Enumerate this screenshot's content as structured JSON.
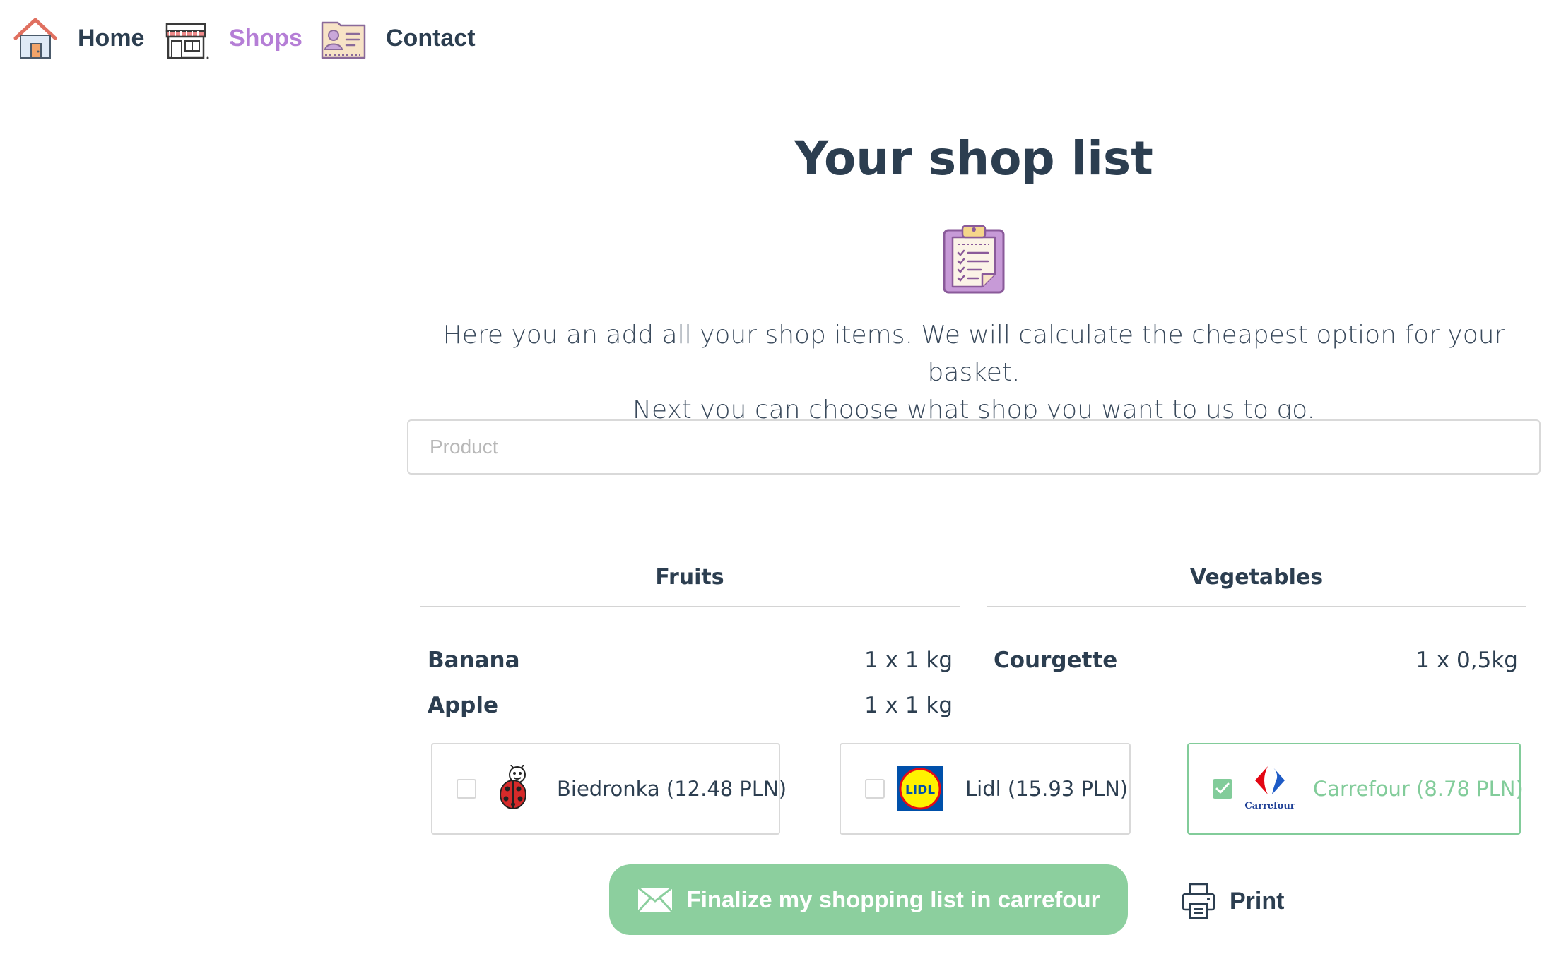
{
  "nav": {
    "items": [
      {
        "label": "Home",
        "icon": "house-icon",
        "active": false
      },
      {
        "label": "Shops",
        "icon": "shop-icon",
        "active": true
      },
      {
        "label": "Contact",
        "icon": "contact-card-icon",
        "active": false
      }
    ]
  },
  "header": {
    "title": "Your shop list",
    "icon": "clipboard-icon",
    "description_line1": "Here you an add all your shop items. We will calculate the cheapest option for your basket.",
    "description_line2": "Next you can choose what shop you want to us to go."
  },
  "search": {
    "placeholder": "Product",
    "value": ""
  },
  "categories": [
    {
      "title": "Fruits",
      "items": [
        {
          "name": "Banana",
          "qty": "1 x 1 kg"
        },
        {
          "name": "Apple",
          "qty": "1 x 1 kg"
        }
      ]
    },
    {
      "title": "Vegetables",
      "items": [
        {
          "name": "Courgette",
          "qty": "1 x 0,5kg"
        }
      ]
    }
  ],
  "shops": [
    {
      "label": "Biedronka (12.48 PLN)",
      "logo": "ladybug-logo",
      "checked": false
    },
    {
      "label": "Lidl (15.93 PLN)",
      "logo": "lidl-logo",
      "logo_text": "LIDL",
      "checked": false
    },
    {
      "label": "Carrefour (8.78 PLN)",
      "logo": "carrefour-logo",
      "logo_text": "Carrefour",
      "checked": true
    }
  ],
  "actions": {
    "finalize_label": "Finalize my shopping list in carrefour",
    "print_label": "Print"
  },
  "colors": {
    "accent_green": "#8ccf9e",
    "active_nav": "#b57ed6",
    "text_dark": "#2c3e50"
  }
}
